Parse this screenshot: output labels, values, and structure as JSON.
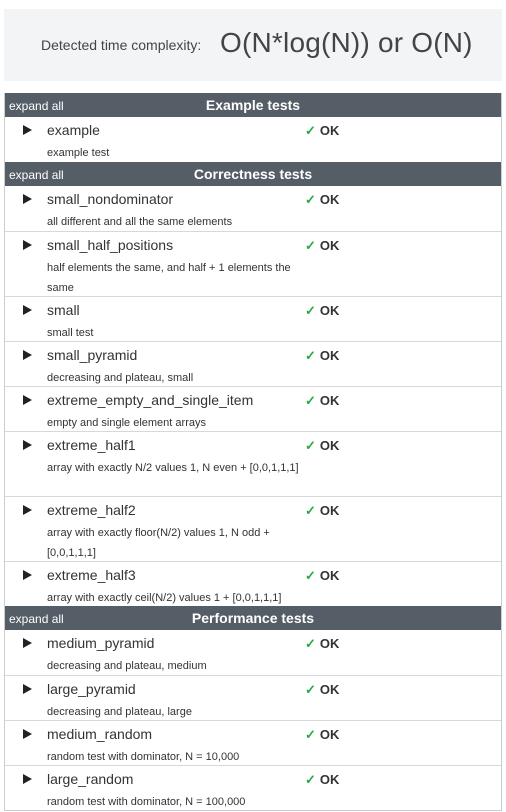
{
  "complexity": {
    "label": "Detected time complexity:",
    "value": "O(N*log(N)) or O(N)"
  },
  "sections": [
    {
      "expand_label": "expand all",
      "title": "Example tests",
      "tests": [
        {
          "name": "example",
          "description": "example test",
          "status": "OK"
        }
      ]
    },
    {
      "expand_label": "expand all",
      "title": "Correctness tests",
      "tests": [
        {
          "name": "small_nondominator",
          "description": "all different and all the same elements",
          "status": "OK"
        },
        {
          "name": "small_half_positions",
          "description": "half elements the same, and half + 1 elements the same",
          "status": "OK"
        },
        {
          "name": "small",
          "description": "small test",
          "status": "OK"
        },
        {
          "name": "small_pyramid",
          "description": "decreasing and plateau, small",
          "status": "OK"
        },
        {
          "name": "extreme_empty_and_single_item",
          "description": "empty and single element arrays",
          "status": "OK"
        },
        {
          "name": "extreme_half1",
          "description": "array with exactly N/2 values 1, N even + [0,0,1,1,1]",
          "status": "OK"
        },
        {
          "name": "extreme_half2",
          "description": "array with exactly floor(N/2) values 1, N odd + [0,0,1,1,1]",
          "status": "OK"
        },
        {
          "name": "extreme_half3",
          "description": "array with exactly ceil(N/2) values 1 + [0,0,1,1,1]",
          "status": "OK"
        }
      ]
    },
    {
      "expand_label": "expand all",
      "title": "Performance tests",
      "tests": [
        {
          "name": "medium_pyramid",
          "description": "decreasing and plateau, medium",
          "status": "OK"
        },
        {
          "name": "large_pyramid",
          "description": "decreasing and plateau, large",
          "status": "OK"
        },
        {
          "name": "medium_random",
          "description": "random test with dominator, N = 10,000",
          "status": "OK"
        },
        {
          "name": "large_random",
          "description": "random test with dominator, N = 100,000",
          "status": "OK"
        }
      ]
    }
  ],
  "icons": {
    "expand": "triangle-right-icon",
    "pass": "checkmark-icon"
  },
  "colors": {
    "header_bg": "#555e67",
    "pass": "#27a844",
    "panel_bg": "#f3f4f6"
  }
}
